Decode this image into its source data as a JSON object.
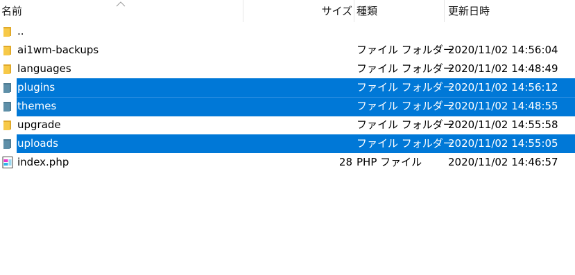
{
  "columns": {
    "name": "名前",
    "size": "サイズ",
    "type": "種類",
    "date": "更新日時"
  },
  "rows": [
    {
      "name": "..",
      "size": "",
      "type": "",
      "date": "",
      "icon": "folder-icon",
      "selected": false
    },
    {
      "name": "ai1wm-backups",
      "size": "",
      "type": "ファイル フォルダー",
      "date": "2020/11/02 14:56:04",
      "icon": "folder-icon",
      "selected": false
    },
    {
      "name": "languages",
      "size": "",
      "type": "ファイル フォルダー",
      "date": "2020/11/02 14:48:49",
      "icon": "folder-icon",
      "selected": false
    },
    {
      "name": "plugins",
      "size": "",
      "type": "ファイル フォルダー",
      "date": "2020/11/02 14:56:12",
      "icon": "folder-icon",
      "selected": true
    },
    {
      "name": "themes",
      "size": "",
      "type": "ファイル フォルダー",
      "date": "2020/11/02 14:48:55",
      "icon": "folder-icon",
      "selected": true
    },
    {
      "name": "upgrade",
      "size": "",
      "type": "ファイル フォルダー",
      "date": "2020/11/02 14:55:58",
      "icon": "folder-icon",
      "selected": false
    },
    {
      "name": "uploads",
      "size": "",
      "type": "ファイル フォルダー",
      "date": "2020/11/02 14:55:05",
      "icon": "folder-icon",
      "selected": true
    },
    {
      "name": "index.php",
      "size": "28",
      "type": "PHP ファイル",
      "date": "2020/11/02 14:46:57",
      "icon": "php-file-icon",
      "selected": false
    }
  ],
  "colors": {
    "selection": "#0078d7",
    "folder": "#f7c948",
    "folder_selected": "#5e8fa8"
  }
}
